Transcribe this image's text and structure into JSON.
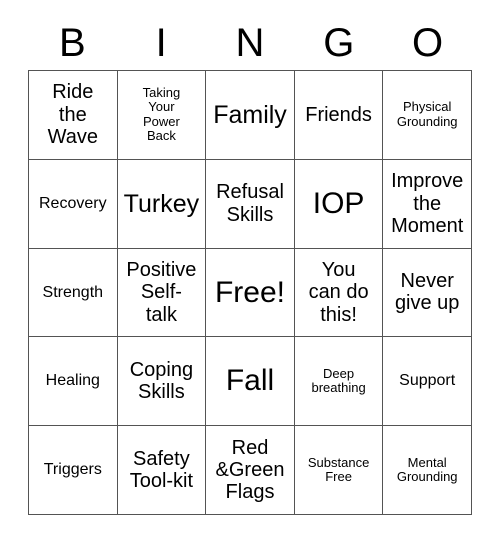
{
  "card": {
    "header": {
      "letters": [
        "B",
        "I",
        "N",
        "G",
        "O"
      ]
    },
    "grid": {
      "rows": 5,
      "columns": 5,
      "free_space_index": 12,
      "border_color": "#545454",
      "cell_background": "#ffffff",
      "text_color": "#000000",
      "cells": [
        {
          "text": "Ride\nthe\nWave",
          "size": "md"
        },
        {
          "text": "Taking\nYour\nPower\nBack",
          "size": "xs"
        },
        {
          "text": "Family",
          "size": "lg"
        },
        {
          "text": "Friends",
          "size": "md"
        },
        {
          "text": "Physical\nGrounding",
          "size": "xs"
        },
        {
          "text": "Recovery",
          "size": "sm"
        },
        {
          "text": "Turkey",
          "size": "lg"
        },
        {
          "text": "Refusal\nSkills",
          "size": "md"
        },
        {
          "text": "IOP",
          "size": "xl"
        },
        {
          "text": "Improve\nthe\nMoment",
          "size": "md"
        },
        {
          "text": "Strength",
          "size": "sm"
        },
        {
          "text": "Positive\nSelf-\ntalk",
          "size": "md"
        },
        {
          "text": "Free!",
          "size": "xl"
        },
        {
          "text": "You\ncan do\nthis!",
          "size": "md"
        },
        {
          "text": "Never\ngive up",
          "size": "md"
        },
        {
          "text": "Healing",
          "size": "sm"
        },
        {
          "text": "Coping\nSkills",
          "size": "md"
        },
        {
          "text": "Fall",
          "size": "xl"
        },
        {
          "text": "Deep\nbreathing",
          "size": "xs"
        },
        {
          "text": "Support",
          "size": "sm"
        },
        {
          "text": "Triggers",
          "size": "sm"
        },
        {
          "text": "Safety\nTool-kit",
          "size": "md"
        },
        {
          "text": "Red\n&Green\nFlags",
          "size": "md"
        },
        {
          "text": "Substance\nFree",
          "size": "xs"
        },
        {
          "text": "Mental\nGrounding",
          "size": "xs"
        }
      ]
    }
  }
}
